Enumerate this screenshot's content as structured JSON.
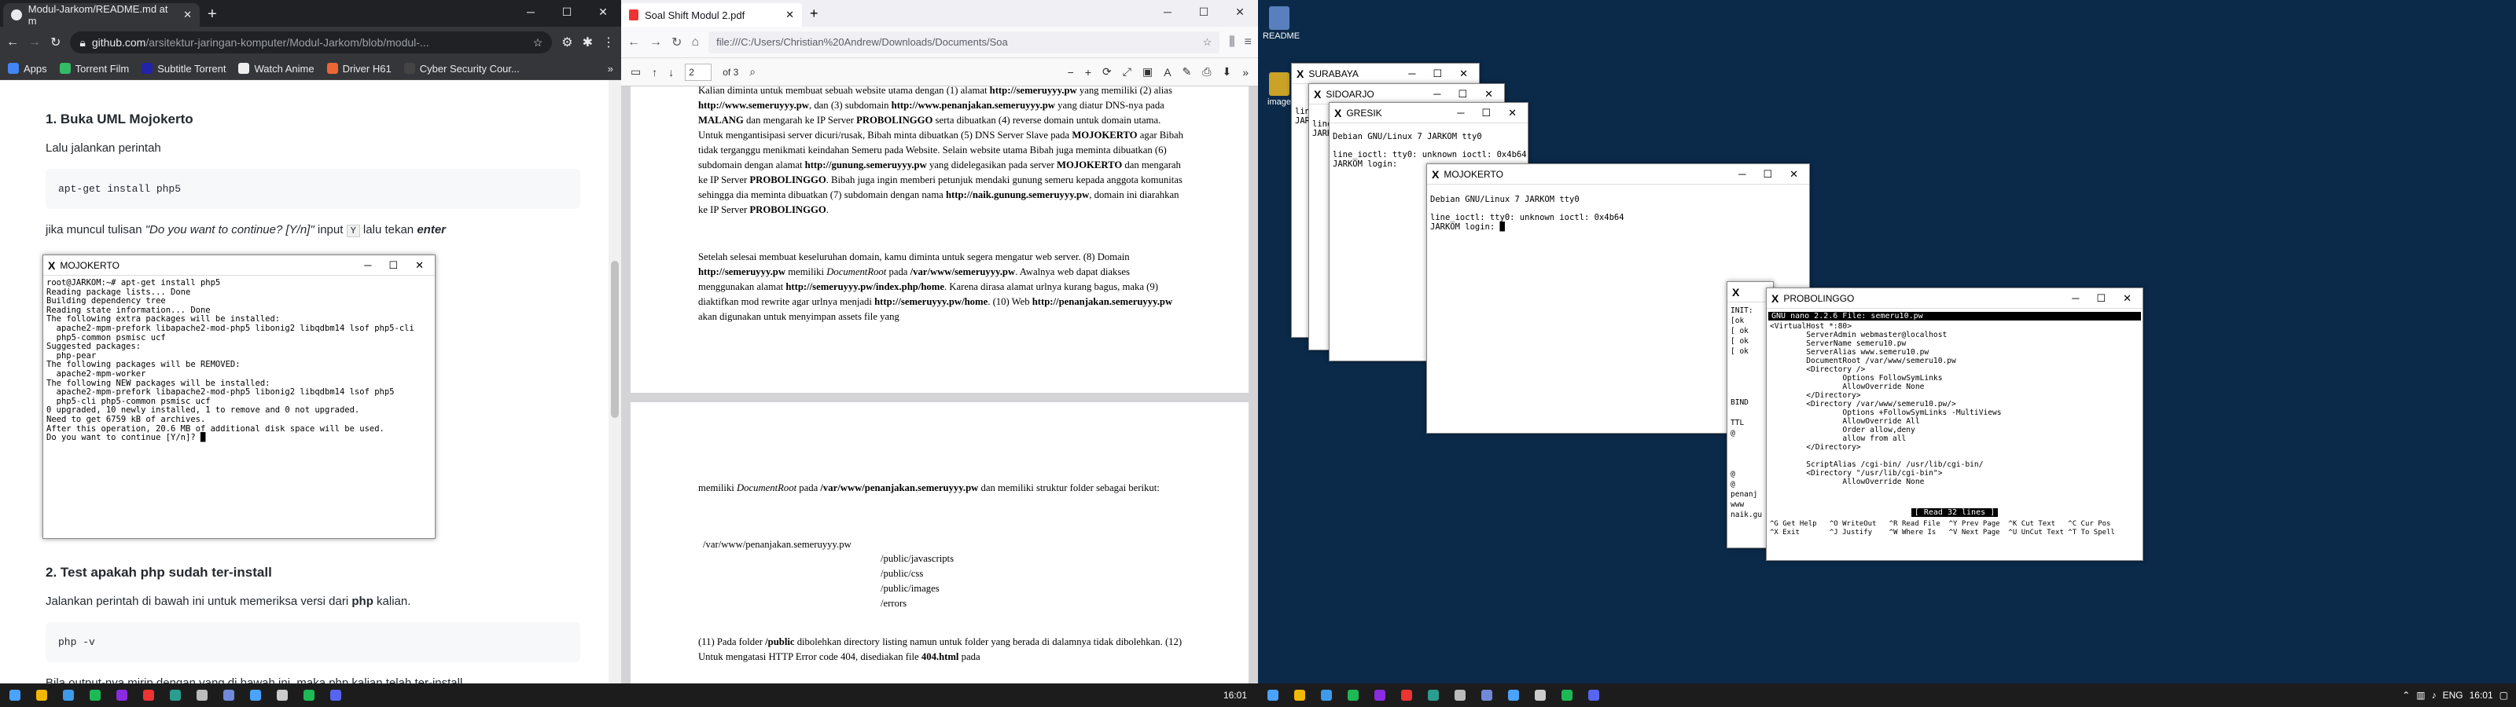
{
  "chrome": {
    "tab_title": "Modul-Jarkom/README.md at m",
    "url_host": "github.com",
    "url_path": "/arsitektur-jaringan-komputer/Modul-Jarkom/blob/modul-...",
    "bookmarks": [
      {
        "label": "Apps",
        "color": "#4285f4"
      },
      {
        "label": "Torrent Film",
        "color": "#3b6"
      },
      {
        "label": "Subtitle Torrent",
        "color": "#22a"
      },
      {
        "label": "Watch Anime",
        "color": "#eee"
      },
      {
        "label": "Driver H61",
        "color": "#e63"
      },
      {
        "label": "Cyber Security Cour...",
        "color": "#444"
      }
    ]
  },
  "readme": {
    "h1": "1. Buka UML Mojokerto",
    "p1": "Lalu jalankan perintah",
    "code1": "apt-get install php5",
    "p2_a": "jika muncul tulisan ",
    "p2_italic": "\"Do you want to continue? [Y/n]\"",
    "p2_b": " input ",
    "p2_key": "Y",
    "p2_c": " lalu tekan ",
    "p2_enter": "enter",
    "h2": "2. Test apakah php sudah ter-install",
    "p3_a": "Jalankan perintah di bawah ini untuk memeriksa versi dari ",
    "p3_bold": "php",
    "p3_b": " kalian.",
    "code2": "php -v",
    "p4": "Bila output-nya mirip dengan yang di bawah ini, maka php kalian telah ter-install"
  },
  "mojokerto": {
    "title": "MOJOKERTO",
    "lines": "root@JARKOM:~# apt-get install php5\nReading package lists... Done\nBuilding dependency tree\nReading state information... Done\nThe following extra packages will be installed:\n  apache2-mpm-prefork libapache2-mod-php5 libonig2 libqdbm14 lsof php5-cli\n  php5-common psmisc ucf\nSuggested packages:\n  php-pear\nThe following packages will be REMOVED:\n  apache2-mpm-worker\nThe following NEW packages will be installed:\n  apache2-mpm-prefork libapache2-mod-php5 libonig2 libqdbm14 lsof php5\n  php5-cli php5-common psmisc ucf\n0 upgraded, 10 newly installed, 1 to remove and 0 not upgraded.\nNeed to get 6759 kB of archives.\nAfter this operation, 20.6 MB of additional disk space will be used.\nDo you want to continue [Y/n]? █"
  },
  "pdf": {
    "tab_title": "Soal Shift Modul 2.pdf",
    "url": "file:///C:/Users/Christian%20Andrew/Downloads/Documents/Soa",
    "page_num": "2",
    "page_total": "of 3",
    "para1": "Kalian diminta untuk membuat sebuah website utama dengan (1) alamat <b>http://semeruyyy.pw</b> yang memiliki (2) alias <b>http://www.semeruyyy.pw</b>, dan (3) subdomain <b>http://www.penanjakan.semeruyyy.pw</b> yang diatur DNS-nya pada <b>MALANG</b> dan mengarah ke IP Server <b>PROBOLINGGO</b> serta dibuatkan (4) reverse domain untuk domain utama. Untuk mengantisipasi server dicuri/rusak, Bibah minta dibuatkan (5) DNS Server Slave pada <b>MOJOKERTO</b> agar Bibah tidak terganggu menikmati keindahan Semeru pada Website. Selain website utama Bibah juga meminta dibuatkan (6) subdomain dengan alamat <b>http://gunung.semeruyyy.pw</b> yang didelegasikan pada server <b>MOJOKERTO</b> dan mengarah ke IP Server <b>PROBOLINGGO</b>. Bibah juga ingin memberi petunjuk mendaki gunung semeru kepada anggota komunitas sehingga dia meminta dibuatkan (7) subdomain dengan nama <b>http://naik.gunung.semeruyyy.pw</b>, domain ini diarahkan ke IP Server <b>PROBOLINGGO</b>.",
    "para2": "Setelah selesai membuat keseluruhan domain, kamu diminta untuk segera mengatur web server. (8) Domain <b>http://semeruyyy.pw</b> memiliki <i>DocumentRoot</i> pada <b>/var/www/semeruyyy.pw</b>. Awalnya web dapat diakses menggunakan alamat <b>http://semeruyyy.pw/index.php/home</b>. Karena dirasa alamat urlnya kurang bagus, maka (9) diaktifkan mod rewrite agar urlnya menjadi <b>http://semeruyyy.pw/home</b>. (10) Web <b>http://penanjakan.semeruyyy.pw</b> akan digunakan untuk menyimpan assets file yang",
    "para3": "memiliki <i>DocumentRoot</i> pada <b>/var/www/penanjakan.semeruyyy.pw</b> dan memiliki struktur folder sebagai berikut:",
    "tree_root": "/var/www/penanjakan.semeruyyy.pw",
    "tree_items": [
      "/public/javascripts",
      "/public/css",
      "/public/images",
      "/errors"
    ],
    "para4": "(11) Pada folder <b>/public</b> dibolehkan directory listing namun untuk folder yang berada di dalamnya tidak dibolehkan. (12) Untuk mengatasi HTTP Error code 404, disediakan file <b>404.html</b> pada"
  },
  "desktop": {
    "icons": [
      {
        "label": "README",
        "color": "#5a7fbf"
      },
      {
        "label": "image",
        "color": "#c9a227"
      }
    ],
    "surabaya_title": "SURABAYA",
    "sidoarjo_title": "SIDOARJO",
    "gresik_title": "GRESIK",
    "mojokerto2_title": "MOJOKERTO",
    "mojokerto2_lines": "Debian GNU/Linux 7 JARKOM tty0\n\nline_ioctl: tty0: unknown ioctl: 0x4b64\nJARKOM login: █",
    "gresik_lines": "Debian GNU/Linux 7 JARKOM tty0\n\nline_ioctl: tty0: unknown ioctl: 0x4b64\nJARKOM login: ",
    "sidoarjo_lines": "line\nJARK",
    "surabaya_lines": "line\nJARK",
    "probo_title": "PROBOLINGGO",
    "nano_header": "  GNU nano 2.2.6                File: semeru10.pw",
    "nano_body": "<VirtualHost *:80>\n        ServerAdmin webmaster@localhost\n        ServerName semeru10.pw\n        ServerAlias www.semeru10.pw\n        DocumentRoot /var/www/semeru10.pw\n        <Directory />\n                Options FollowSymLinks\n                AllowOverride None\n        </Directory>\n        <Directory /var/www/semeru10.pw/>\n                Options +FollowSymLinks -MultiViews\n                AllowOverride All\n                Order allow,deny\n                allow from all\n        </Directory>\n\n        ScriptAlias /cgi-bin/ /usr/lib/cgi-bin/\n        <Directory \"/usr/lib/cgi-bin\">\n                AllowOverride None",
    "nano_status": "[ Read 32 lines ]",
    "nano_help1": "^G Get Help   ^O WriteOut   ^R Read File  ^Y Prev Page  ^K Cut Text   ^C Cur Pos",
    "nano_help2": "^X Exit       ^J Justify    ^W Where Is   ^V Next Page  ^U UnCut Text ^T To Spell",
    "left_partial": "INIT:\n[ok\n[ ok\n[ ok\n[ ok\n\n\n\n\nBIND\n\nTTL\n@\n\n\n\n@\n@\npenanj\nwww\nnaik.gu"
  },
  "taskbar": {
    "left_clock": "16:01",
    "right_clock": "16:01"
  }
}
